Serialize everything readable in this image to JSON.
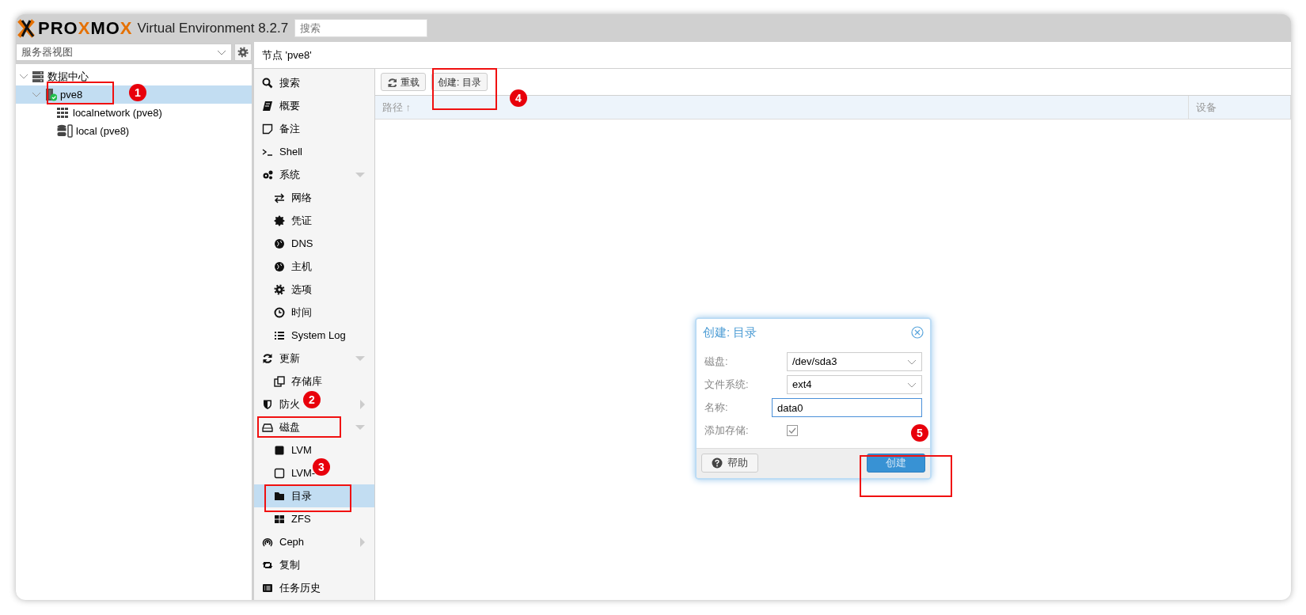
{
  "header": {
    "logo": [
      {
        "text": "PRO",
        "accent": false
      },
      {
        "text": "X",
        "accent": true
      },
      {
        "text": "MO",
        "accent": false
      },
      {
        "text": "X",
        "accent": true
      }
    ],
    "product": "Virtual Environment 8.2.7",
    "search": {
      "placeholder": "搜索"
    }
  },
  "sidebar": {
    "view_select": "服务器视图",
    "tree": [
      {
        "label": "数据中心",
        "kind": "datacenter",
        "expanded": true,
        "selected": false,
        "children": [
          {
            "label": "pve8",
            "kind": "node",
            "expanded": true,
            "selected": true,
            "online": true,
            "children": [
              {
                "label": "localnetwork (pve8)",
                "kind": "network",
                "selected": false
              },
              {
                "label": "local (pve8)",
                "kind": "storage",
                "selected": false
              }
            ]
          }
        ]
      }
    ]
  },
  "panel_title": "节点 'pve8'",
  "nav": [
    {
      "label": "搜索",
      "selected": false
    },
    {
      "label": "概要",
      "selected": false
    },
    {
      "label": "备注",
      "selected": false
    },
    {
      "label": "Shell",
      "selected": false
    },
    {
      "label": "系统",
      "selected": false,
      "expanded": true,
      "children": [
        {
          "label": "网络",
          "selected": false
        },
        {
          "label": "凭证",
          "selected": false
        },
        {
          "label": "DNS",
          "selected": false
        },
        {
          "label": "主机",
          "selected": false
        },
        {
          "label": "选项",
          "selected": false
        },
        {
          "label": "时间",
          "selected": false
        },
        {
          "label": "System Log",
          "selected": false
        }
      ]
    },
    {
      "label": "更新",
      "selected": false,
      "expanded": true,
      "children": [
        {
          "label": "存储库",
          "selected": false
        }
      ]
    },
    {
      "label": "防火",
      "selected": false,
      "expanded": false
    },
    {
      "label": "磁盘",
      "selected": false,
      "expanded": true,
      "children": [
        {
          "label": "LVM",
          "selected": false
        },
        {
          "label": "LVM-",
          "selected": false
        },
        {
          "label": "目录",
          "selected": true
        },
        {
          "label": "ZFS",
          "selected": false
        }
      ]
    },
    {
      "label": "Ceph",
      "selected": false,
      "expanded": false
    },
    {
      "label": "复制",
      "selected": false
    },
    {
      "label": "任务历史",
      "selected": false
    }
  ],
  "toolbar": {
    "buttons": [
      {
        "label": "重载",
        "kind": "reload"
      },
      {
        "label": "创建: 目录",
        "kind": "plain"
      }
    ]
  },
  "table": {
    "columns": [
      "路径 ↑",
      "设备"
    ]
  },
  "dialog": {
    "title": "创建: 目录",
    "fields": [
      {
        "label": "磁盘:",
        "kind": "select",
        "value": "/dev/sda3"
      },
      {
        "label": "文件系统:",
        "kind": "select",
        "value": "ext4"
      },
      {
        "label": "名称:",
        "kind": "text",
        "value": "data0"
      },
      {
        "label": "添加存储:",
        "kind": "checkbox",
        "checked": true
      }
    ],
    "buttons": [
      {
        "label": "帮助",
        "kind": "help"
      },
      {
        "label": "创建",
        "kind": "primary"
      }
    ]
  },
  "annotations": [
    {
      "label": "1"
    },
    {
      "label": "2"
    },
    {
      "label": "3"
    },
    {
      "label": "4"
    },
    {
      "label": "5"
    }
  ]
}
